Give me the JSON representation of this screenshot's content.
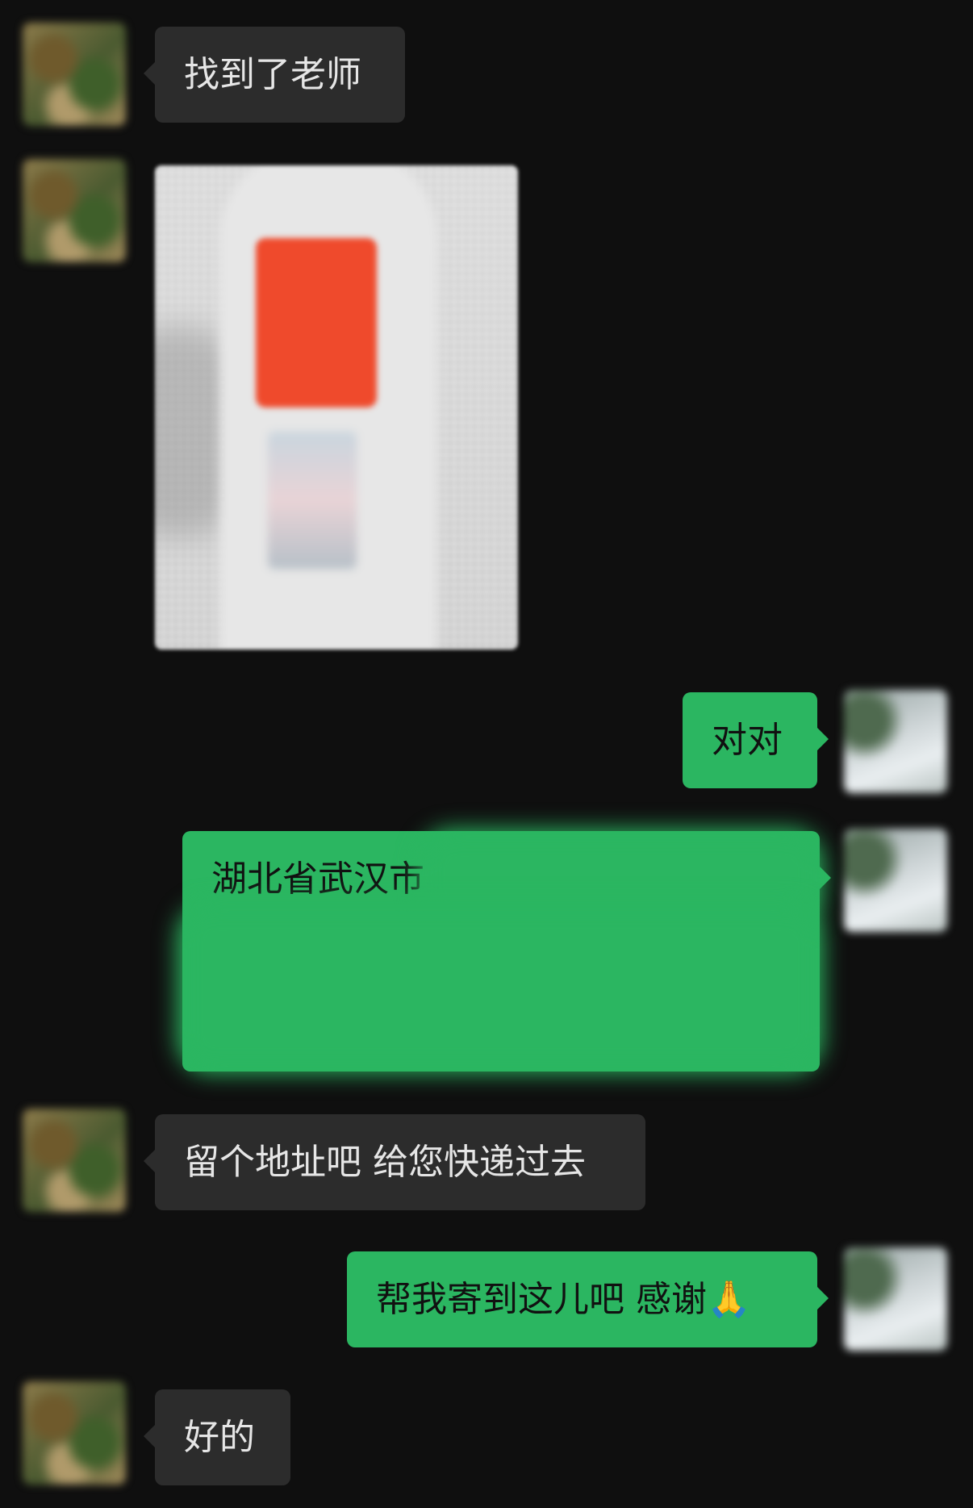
{
  "messages": [
    {
      "side": "them",
      "text": "找到了老师"
    },
    {
      "side": "them",
      "type": "image",
      "image_desc": "blurred photo of a bottle with red label on mesh background"
    },
    {
      "side": "me",
      "text": "对对"
    },
    {
      "side": "me",
      "text_visible": "湖北省武汉市",
      "redacted": true
    },
    {
      "side": "them",
      "text": "留个地址吧 给您快递过去"
    },
    {
      "side": "me",
      "text": "帮我寄到这儿吧 感谢🙏"
    },
    {
      "side": "them",
      "text": "好的"
    }
  ],
  "colors": {
    "background": "#0f0f0f",
    "incoming_bubble": "#2c2c2c",
    "outgoing_bubble": "#2bb661"
  }
}
